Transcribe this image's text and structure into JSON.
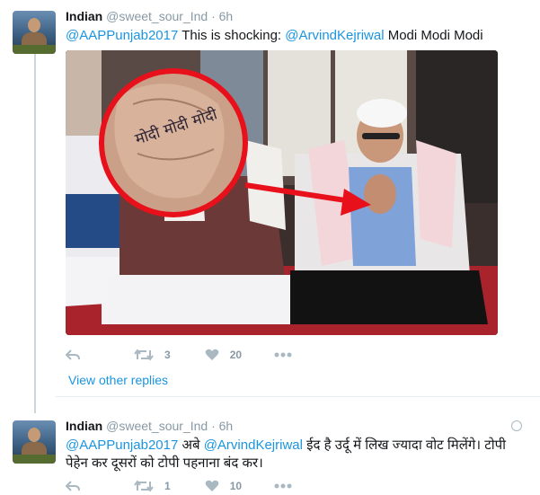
{
  "tweet1": {
    "name": "Indian",
    "handle": "@sweet_sour_Ind",
    "dot": "·",
    "time": "6h",
    "mention1": "@AAPPunjab2017",
    "text_mid": " This is shocking: ",
    "mention2": "@ArvindKejriwal",
    "text_end": " Modi Modi Modi",
    "image_hand_text": "मोदी मोदी मोदी",
    "retweets": "3",
    "likes": "20"
  },
  "view_other_replies": "View other replies",
  "tweet2": {
    "name": "Indian",
    "handle": "@sweet_sour_Ind",
    "dot": "·",
    "time": "6h",
    "mention1": "@AAPPunjab2017",
    "text_a": " अबे ",
    "mention2": "@ArvindKejriwal",
    "text_b": " ईद है उर्दू में लिख ज्यादा वोट मिलेंगे। टोपी पेहेन कर दूसरों को टोपी पहनाना बंद कर।",
    "retweets": "1",
    "likes": "10"
  },
  "icons": [
    "reply-icon",
    "retweet-icon",
    "heart-icon",
    "more-icon",
    "globe-icon"
  ],
  "colors": {
    "link": "#1b95e0",
    "meta": "#8899a6",
    "annotation_red": "#e8101b"
  }
}
